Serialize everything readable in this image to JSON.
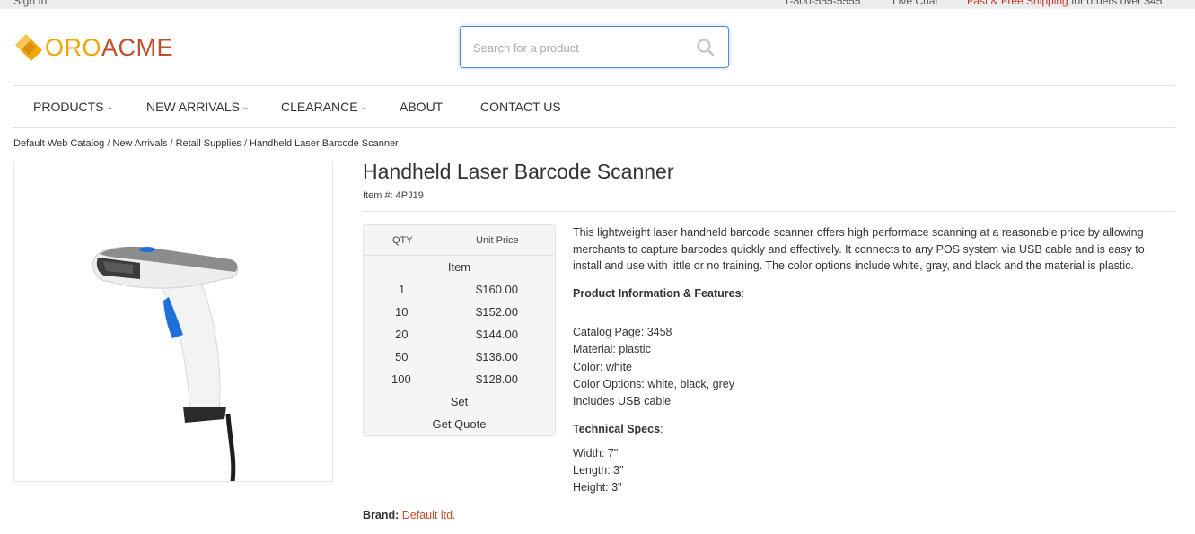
{
  "topbar": {
    "sign_in": "Sign In",
    "phone": "1-800-555-5555",
    "live_chat": "Live Chat",
    "promo_link": "Fast & Free Shipping",
    "promo_text": " for orders over $45"
  },
  "logo": {
    "oro": "ORO",
    "acme": "ACME"
  },
  "search": {
    "placeholder": "Search for a product",
    "icon": "search-icon"
  },
  "nav": [
    {
      "label": "PRODUCTS",
      "dropdown": true
    },
    {
      "label": "NEW ARRIVALS",
      "dropdown": true
    },
    {
      "label": "CLEARANCE",
      "dropdown": true
    },
    {
      "label": "ABOUT",
      "dropdown": false
    },
    {
      "label": "CONTACT US",
      "dropdown": false
    }
  ],
  "breadcrumb": [
    "Default Web Catalog",
    "New Arrivals",
    "Retail Supplies",
    "Handheld Laser Barcode Scanner"
  ],
  "product": {
    "title": "Handheld Laser Barcode Scanner",
    "item_number": "Item #: 4PJ19",
    "description": "This lightweight laser handheld barcode scanner offers high performace scanning at a reasonable price by allowing merchants to capture barcodes quickly and effectively. It connects to any POS system via USB cable and is easy to install and use with little or no training. The color options include white, gray, and black and the material is plastic.",
    "info_heading": "Product Information & Features",
    "info_heading_suffix": ":",
    "info_lines": [
      "Catalog Page: 3458",
      "Material: plastic",
      "Color: white",
      "Color Options: white, black, grey",
      "Includes USB cable"
    ],
    "specs_heading": "Technical Specs",
    "specs_heading_suffix": ":",
    "specs_lines": [
      "Width: 7\"",
      "Length: 3\"",
      "Height: 3\""
    ],
    "brand_label": "Brand:",
    "brand_value": "Default ltd."
  },
  "price_table": {
    "qty_header": "QTY",
    "price_header": "Unit Price",
    "unit_item": "Item",
    "rows": [
      {
        "qty": "1",
        "price": "$160.00"
      },
      {
        "qty": "10",
        "price": "$152.00"
      },
      {
        "qty": "20",
        "price": "$144.00"
      },
      {
        "qty": "50",
        "price": "$136.00"
      },
      {
        "qty": "100",
        "price": "$128.00"
      }
    ],
    "unit_set": "Set",
    "get_quote": "Get Quote"
  },
  "colors": {
    "accent_orange": "#f0a500",
    "brand_red": "#c0502b",
    "focus_blue": "#4a90c8",
    "scanner_blue": "#1e6fd9"
  }
}
